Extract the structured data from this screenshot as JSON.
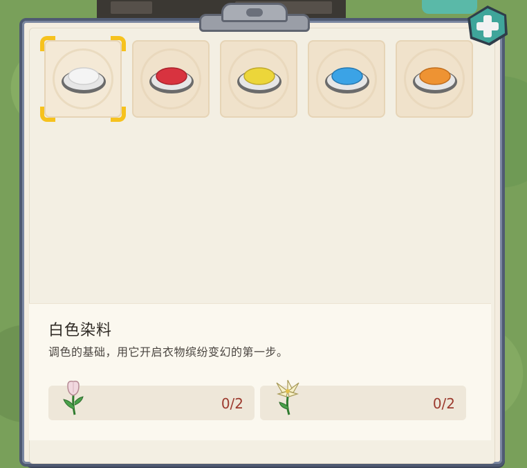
{
  "dyes": [
    {
      "name": "white-dye",
      "color": "#f4f4f4"
    },
    {
      "name": "red-dye",
      "color": "#d8333f"
    },
    {
      "name": "yellow-dye",
      "color": "#ecd63a"
    },
    {
      "name": "blue-dye",
      "color": "#3ba3e6"
    },
    {
      "name": "orange-dye",
      "color": "#ee9333"
    }
  ],
  "selected_index": 0,
  "item": {
    "name": "白色染料",
    "description": "调色的基础，用它开启衣物缤纷变幻的第一步。"
  },
  "materials": [
    {
      "icon": "tulip-icon",
      "count": "0/2"
    },
    {
      "icon": "lily-icon",
      "count": "0/2"
    }
  ],
  "colors": {
    "border": "#4f5a72",
    "panel": "#f3efe3",
    "selection": "#f6c21e",
    "count_text": "#9c3a2e",
    "plus_button": "#3fa59a"
  }
}
